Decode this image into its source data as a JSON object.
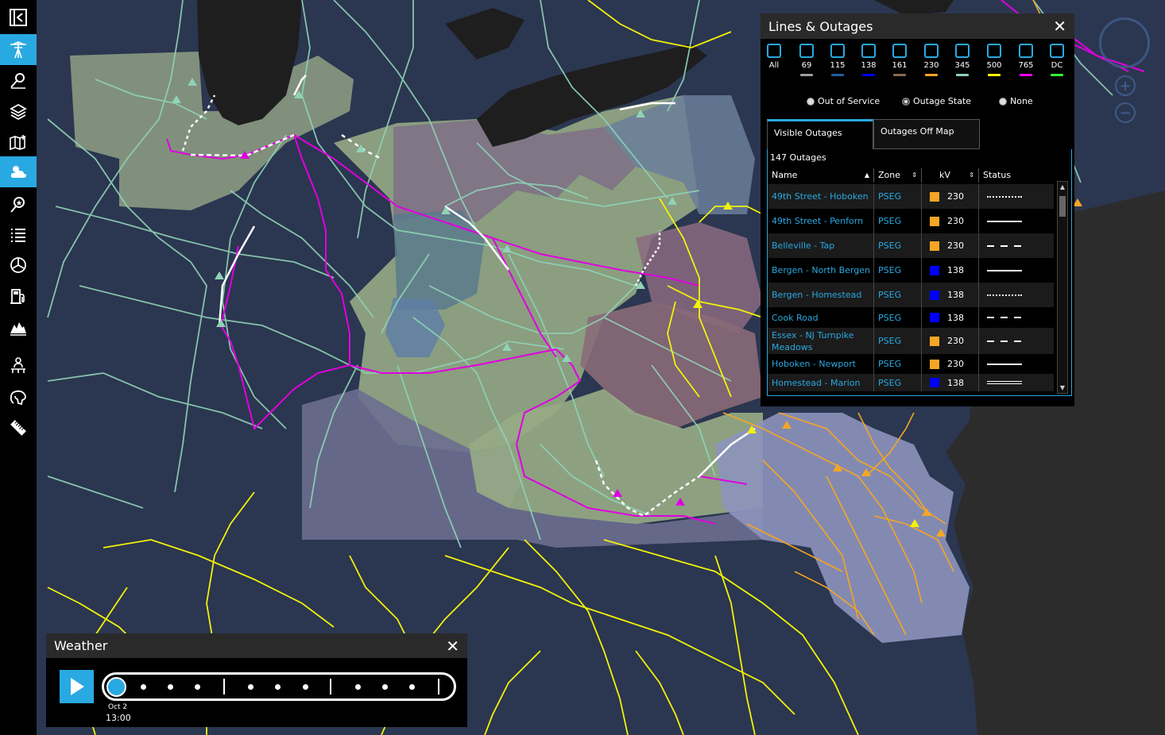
{
  "sidebar": {
    "items": [
      {
        "icon": "collapse-icon",
        "active": false
      },
      {
        "icon": "power-tower-icon",
        "active": true
      },
      {
        "icon": "location-search-icon",
        "active": false
      },
      {
        "icon": "layers-icon",
        "active": false
      },
      {
        "icon": "map-add-icon",
        "active": false
      },
      {
        "icon": "weather-icon",
        "active": true
      },
      {
        "icon": "favorite-search-icon",
        "active": false
      },
      {
        "icon": "list-icon",
        "active": false
      },
      {
        "icon": "dashboard-icon",
        "active": false
      },
      {
        "icon": "fuel-station-icon",
        "active": false
      },
      {
        "icon": "terrain-icon",
        "active": false
      },
      {
        "icon": "network-user-icon",
        "active": false
      },
      {
        "icon": "brain-icon",
        "active": false
      },
      {
        "icon": "ruler-icon",
        "active": false
      }
    ]
  },
  "outages_panel": {
    "title": "Lines & Outages",
    "close": "✕",
    "kv_filters": [
      {
        "label": "All",
        "color": ""
      },
      {
        "label": "69",
        "color": "#9e9e9e"
      },
      {
        "label": "115",
        "color": "#1f5f9f"
      },
      {
        "label": "138",
        "color": "#0000ff"
      },
      {
        "label": "161",
        "color": "#8a6b4e"
      },
      {
        "label": "230",
        "color": "#f5a623"
      },
      {
        "label": "345",
        "color": "#8fd3b6"
      },
      {
        "label": "500",
        "color": "#ffff00"
      },
      {
        "label": "765",
        "color": "#ff00ff"
      },
      {
        "label": "DC",
        "color": "#33ff33"
      }
    ],
    "display_options": [
      {
        "label": "Out of Service",
        "selected": false
      },
      {
        "label": "Outage State",
        "selected": true
      },
      {
        "label": "None",
        "selected": false
      }
    ],
    "tabs": [
      {
        "label": "Visible Outages",
        "active": true
      },
      {
        "label": "Outages Off Map",
        "active": false
      }
    ],
    "count_label": "147 Outages",
    "columns": [
      "Name",
      "Zone",
      "kV",
      "Status"
    ],
    "rows": [
      {
        "name": "49th Street - Hoboken",
        "zone": "PSEG",
        "kv": "230",
        "kv_color": "#f5a623",
        "status": "dotted"
      },
      {
        "name": "49th Street - Penforn",
        "zone": "PSEG",
        "kv": "230",
        "kv_color": "#f5a623",
        "status": "solid"
      },
      {
        "name": "Belleville - Tap",
        "zone": "PSEG",
        "kv": "230",
        "kv_color": "#f5a623",
        "status": "dashed"
      },
      {
        "name": "Bergen - North Bergen",
        "zone": "PSEG",
        "kv": "138",
        "kv_color": "#0000ff",
        "status": "solid"
      },
      {
        "name": "Bergen - Homestead",
        "zone": "PSEG",
        "kv": "138",
        "kv_color": "#0000ff",
        "status": "dotted"
      },
      {
        "name": "Cook Road",
        "zone": "PSEG",
        "kv": "138",
        "kv_color": "#0000ff",
        "status": "dashed"
      },
      {
        "name": "Essex - NJ Turnpike Meadows",
        "zone": "PSEG",
        "kv": "230",
        "kv_color": "#f5a623",
        "status": "dashed"
      },
      {
        "name": "Hoboken - Newport",
        "zone": "PSEG",
        "kv": "230",
        "kv_color": "#f5a623",
        "status": "solid"
      },
      {
        "name": "Homestead - Marion",
        "zone": "PSEG",
        "kv": "138",
        "kv_color": "#0000ff",
        "status": "double"
      }
    ]
  },
  "weather_panel": {
    "title": "Weather",
    "close": "✕",
    "date": "Oct 2",
    "time": "13:00"
  },
  "colors": {
    "accent": "#29a9e1",
    "map_bg": "#2b3650",
    "lake": "#222222",
    "ocean": "#2c2c2c"
  }
}
